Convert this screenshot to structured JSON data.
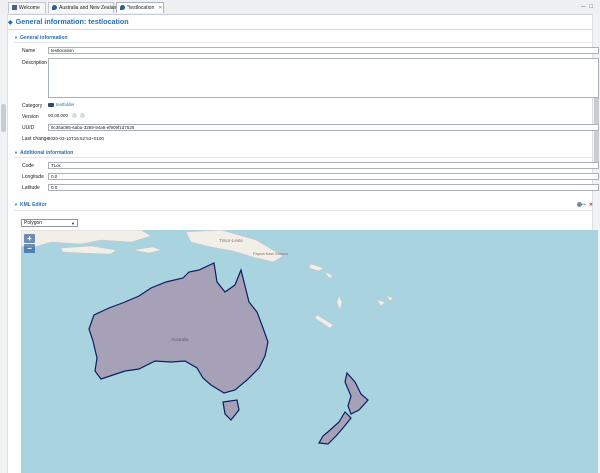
{
  "tabs": [
    {
      "label": "Welcome"
    },
    {
      "label": "Australia and New Zealand"
    },
    {
      "label": "*testlocation"
    }
  ],
  "page_title": "General information: testlocation",
  "sections": {
    "general": "General information",
    "additional": "Additional information",
    "kml": "KML Editor"
  },
  "general": {
    "name_label": "Name",
    "name_value": "testlocation",
    "description_label": "Description",
    "description_value": "",
    "category_label": "Category",
    "category_value": "testfolder",
    "version_label": "Version",
    "version_value": "00.00.000",
    "uuid_label": "UUID",
    "uuid_value": "9c36a095-6aba-3289-94a6-ef909f1d7528",
    "last_change_label": "Last change",
    "last_change_value": "2020-03-10T16:52:53+0100"
  },
  "additional": {
    "code_label": "Code",
    "code_value": "TLoc",
    "longitude_label": "Longitude",
    "longitude_value": "0.0",
    "latitude_label": "Latitude",
    "latitude_value": "0.0"
  },
  "kml": {
    "shape_selected": "Polygon",
    "zoom_in": "+",
    "zoom_out": "−",
    "map_labels": {
      "timor": "Timor-Leste",
      "australia": "Australia",
      "png": "Papua New Guinea"
    }
  },
  "colors": {
    "accent": "#2a6fb0",
    "sea": "#a9d3df",
    "land": "#f2efe9",
    "polygon_fill": "#a7a1b8",
    "polygon_stroke": "#0a1f63"
  }
}
